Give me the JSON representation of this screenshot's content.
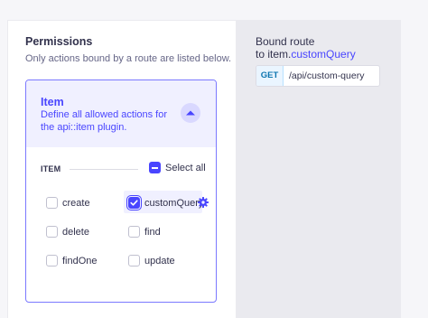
{
  "permissions": {
    "title": "Permissions",
    "subtitle": "Only actions bound by a route are listed below."
  },
  "card": {
    "title": "Item",
    "description": "Define all allowed actions for the api::item plugin.",
    "section_label": "ITEM",
    "select_all_label": "Select all",
    "select_all_state": "indeterminate",
    "actions": [
      {
        "label": "create",
        "checked": false
      },
      {
        "label": "customQuery",
        "checked": true
      },
      {
        "label": "delete",
        "checked": false
      },
      {
        "label": "find",
        "checked": false
      },
      {
        "label": "findOne",
        "checked": false
      },
      {
        "label": "update",
        "checked": false
      }
    ]
  },
  "bound_route": {
    "title_line1": "Bound route",
    "title_prefix": "to item.",
    "title_highlight": "customQuery",
    "method": "GET",
    "path": "/api/custom-query"
  },
  "colors": {
    "accent": "#4945ff",
    "get_method": "#0c75af"
  },
  "icons": {
    "collapse": "chevron-up-icon",
    "settings": "gear-icon",
    "check": "check-icon"
  }
}
